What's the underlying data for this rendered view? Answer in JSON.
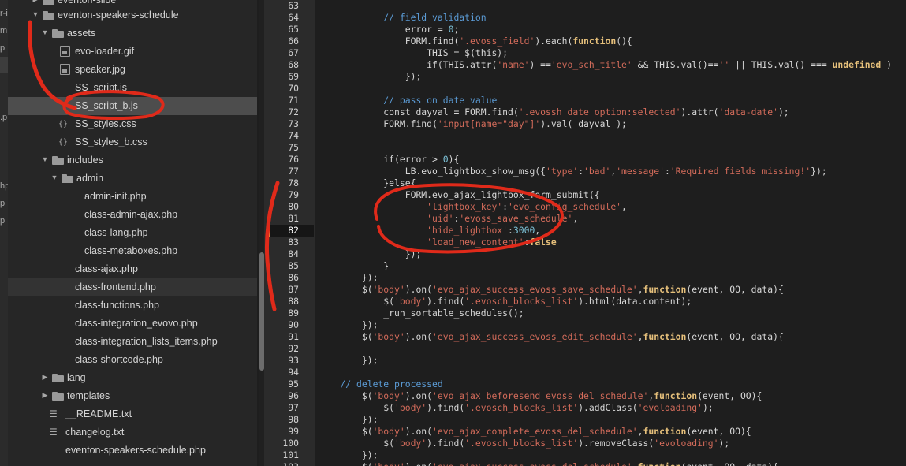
{
  "sidebar": {
    "top_cut": "eventon-slide",
    "items": [
      {
        "label": "eventon-speakers-schedule",
        "type": "folder",
        "level": 0,
        "open": true
      },
      {
        "label": "assets",
        "type": "folder",
        "level": 1,
        "open": true
      },
      {
        "label": "evo-loader.gif",
        "type": "image",
        "level": 2
      },
      {
        "label": "speaker.jpg",
        "type": "image",
        "level": 2
      },
      {
        "label": "SS_script.js",
        "type": "js",
        "level": 2
      },
      {
        "label": "SS_script_b.js",
        "type": "js",
        "level": 2,
        "active": true
      },
      {
        "label": "SS_styles.css",
        "type": "css",
        "level": 2
      },
      {
        "label": "SS_styles_b.css",
        "type": "css",
        "level": 2
      },
      {
        "label": "includes",
        "type": "folder",
        "level": 1,
        "open": true
      },
      {
        "label": "admin",
        "type": "folder",
        "level": 2,
        "open": true
      },
      {
        "label": "admin-init.php",
        "type": "php",
        "level": 3
      },
      {
        "label": "class-admin-ajax.php",
        "type": "php",
        "level": 3
      },
      {
        "label": "class-lang.php",
        "type": "php",
        "level": 3
      },
      {
        "label": "class-metaboxes.php",
        "type": "php",
        "level": 3
      },
      {
        "label": "class-ajax.php",
        "type": "php",
        "level": 2
      },
      {
        "label": "class-frontend.php",
        "type": "php",
        "level": 2,
        "hover": true
      },
      {
        "label": "class-functions.php",
        "type": "php",
        "level": 2
      },
      {
        "label": "class-integration_evovo.php",
        "type": "php",
        "level": 2
      },
      {
        "label": "class-integration_lists_items.php",
        "type": "php",
        "level": 2
      },
      {
        "label": "class-shortcode.php",
        "type": "php",
        "level": 2
      },
      {
        "label": "lang",
        "type": "folder",
        "level": 1,
        "open": false
      },
      {
        "label": "templates",
        "type": "folder",
        "level": 1,
        "open": false
      },
      {
        "label": "__README.txt",
        "type": "text",
        "level": 1
      },
      {
        "label": "changelog.txt",
        "type": "text",
        "level": 1
      },
      {
        "label": "eventon-speakers-schedule.php",
        "type": "php",
        "level": 1
      }
    ]
  },
  "leftstrip": {
    "fragments": [
      "r-i",
      "m",
      "p",
      ".p",
      "hp",
      "p",
      "p"
    ]
  },
  "editor": {
    "current_line": 82,
    "lines": [
      {
        "n": 63,
        "tokens": []
      },
      {
        "n": 64,
        "tokens": [
          [
            "comment",
            "            // field validation"
          ]
        ]
      },
      {
        "n": 65,
        "tokens": [
          [
            "plain",
            "                error = "
          ],
          [
            "number",
            "0"
          ],
          [
            "plain",
            ";"
          ]
        ]
      },
      {
        "n": 66,
        "tokens": [
          [
            "plain",
            "                FORM.find("
          ],
          [
            "string",
            "'.evoss_field'"
          ],
          [
            "plain",
            ").each("
          ],
          [
            "kw",
            "function"
          ],
          [
            "plain",
            "(){"
          ]
        ]
      },
      {
        "n": 67,
        "tokens": [
          [
            "plain",
            "                    THIS = $(this);"
          ]
        ]
      },
      {
        "n": 68,
        "tokens": [
          [
            "plain",
            "                    if(THIS.attr("
          ],
          [
            "string",
            "'name'"
          ],
          [
            "plain",
            ") =="
          ],
          [
            "string",
            "'evo_sch_title'"
          ],
          [
            "plain",
            " && THIS.val()=="
          ],
          [
            "string",
            "''"
          ],
          [
            "plain",
            " || THIS.val() === "
          ],
          [
            "kw",
            "undefined"
          ],
          [
            "plain",
            " )"
          ]
        ]
      },
      {
        "n": 69,
        "tokens": [
          [
            "plain",
            "                });"
          ]
        ]
      },
      {
        "n": 70,
        "tokens": []
      },
      {
        "n": 71,
        "tokens": [
          [
            "comment",
            "            // pass on date value"
          ]
        ]
      },
      {
        "n": 72,
        "tokens": [
          [
            "plain",
            "            const dayval = FORM.find("
          ],
          [
            "string",
            "'.evossh_date option:selected'"
          ],
          [
            "plain",
            ").attr("
          ],
          [
            "string",
            "'data-date'"
          ],
          [
            "plain",
            ");"
          ]
        ]
      },
      {
        "n": 73,
        "tokens": [
          [
            "plain",
            "            FORM.find("
          ],
          [
            "string",
            "'input[name=\"day\"]'"
          ],
          [
            "plain",
            ").val( dayval );"
          ]
        ]
      },
      {
        "n": 74,
        "tokens": []
      },
      {
        "n": 75,
        "tokens": []
      },
      {
        "n": 76,
        "tokens": [
          [
            "plain",
            "            if(error > "
          ],
          [
            "number",
            "0"
          ],
          [
            "plain",
            "){"
          ]
        ]
      },
      {
        "n": 77,
        "tokens": [
          [
            "plain",
            "                LB.evo_lightbox_show_msg({"
          ],
          [
            "string",
            "'type'"
          ],
          [
            "plain",
            ":"
          ],
          [
            "string",
            "'bad'"
          ],
          [
            "plain",
            ","
          ],
          [
            "string",
            "'message'"
          ],
          [
            "plain",
            ":"
          ],
          [
            "string",
            "'Required fields missing!'"
          ],
          [
            "plain",
            "});"
          ]
        ]
      },
      {
        "n": 78,
        "tokens": [
          [
            "plain",
            "            }else{"
          ]
        ]
      },
      {
        "n": 79,
        "tokens": [
          [
            "plain",
            "                FORM.evo_ajax_lightbox_form_submit({"
          ]
        ]
      },
      {
        "n": 80,
        "tokens": [
          [
            "plain",
            "                    "
          ],
          [
            "string",
            "'lightbox_key'"
          ],
          [
            "plain",
            ":"
          ],
          [
            "string",
            "'evo_config_schedule'"
          ],
          [
            "plain",
            ","
          ]
        ]
      },
      {
        "n": 81,
        "tokens": [
          [
            "plain",
            "                    "
          ],
          [
            "string",
            "'uid'"
          ],
          [
            "plain",
            ":"
          ],
          [
            "string",
            "'evoss_save_schedule'"
          ],
          [
            "plain",
            ","
          ]
        ]
      },
      {
        "n": 82,
        "tokens": [
          [
            "plain",
            "                    "
          ],
          [
            "string",
            "'hide_lightbox'"
          ],
          [
            "plain",
            ":"
          ],
          [
            "number",
            "3000"
          ],
          [
            "plain",
            ","
          ]
        ]
      },
      {
        "n": 83,
        "tokens": [
          [
            "plain",
            "                    "
          ],
          [
            "string",
            "'load_new_content'"
          ],
          [
            "plain",
            ":"
          ],
          [
            "kw",
            "false"
          ]
        ]
      },
      {
        "n": 84,
        "tokens": [
          [
            "plain",
            "                });"
          ]
        ]
      },
      {
        "n": 85,
        "tokens": [
          [
            "plain",
            "            }"
          ]
        ]
      },
      {
        "n": 86,
        "tokens": [
          [
            "plain",
            "        });"
          ]
        ]
      },
      {
        "n": 87,
        "tokens": [
          [
            "plain",
            "        $("
          ],
          [
            "string",
            "'body'"
          ],
          [
            "plain",
            ").on("
          ],
          [
            "string",
            "'evo_ajax_success_evoss_save_schedule'"
          ],
          [
            "plain",
            ","
          ],
          [
            "kw",
            "function"
          ],
          [
            "plain",
            "(event, OO, data){"
          ]
        ]
      },
      {
        "n": 88,
        "tokens": [
          [
            "plain",
            "            $("
          ],
          [
            "string",
            "'body'"
          ],
          [
            "plain",
            ").find("
          ],
          [
            "string",
            "'.evosch_blocks_list'"
          ],
          [
            "plain",
            ").html(data.content);"
          ]
        ]
      },
      {
        "n": 89,
        "tokens": [
          [
            "plain",
            "            _run_sortable_schedules();"
          ]
        ]
      },
      {
        "n": 90,
        "tokens": [
          [
            "plain",
            "        });"
          ]
        ]
      },
      {
        "n": 91,
        "tokens": [
          [
            "plain",
            "        $("
          ],
          [
            "string",
            "'body'"
          ],
          [
            "plain",
            ").on("
          ],
          [
            "string",
            "'evo_ajax_success_evoss_edit_schedule'"
          ],
          [
            "plain",
            ","
          ],
          [
            "kw",
            "function"
          ],
          [
            "plain",
            "(event, OO, data){"
          ]
        ]
      },
      {
        "n": 92,
        "tokens": []
      },
      {
        "n": 93,
        "tokens": [
          [
            "plain",
            "        });"
          ]
        ]
      },
      {
        "n": 94,
        "tokens": []
      },
      {
        "n": 95,
        "tokens": [
          [
            "comment",
            "    // delete processed"
          ]
        ]
      },
      {
        "n": 96,
        "tokens": [
          [
            "plain",
            "        $("
          ],
          [
            "string",
            "'body'"
          ],
          [
            "plain",
            ").on("
          ],
          [
            "string",
            "'evo_ajax_beforesend_evoss_del_schedule'"
          ],
          [
            "plain",
            ","
          ],
          [
            "kw",
            "function"
          ],
          [
            "plain",
            "(event, OO){"
          ]
        ]
      },
      {
        "n": 97,
        "tokens": [
          [
            "plain",
            "            $("
          ],
          [
            "string",
            "'body'"
          ],
          [
            "plain",
            ").find("
          ],
          [
            "string",
            "'.evosch_blocks_list'"
          ],
          [
            "plain",
            ").addClass("
          ],
          [
            "string",
            "'evoloading'"
          ],
          [
            "plain",
            ");"
          ]
        ]
      },
      {
        "n": 98,
        "tokens": [
          [
            "plain",
            "        });"
          ]
        ]
      },
      {
        "n": 99,
        "tokens": [
          [
            "plain",
            "        $("
          ],
          [
            "string",
            "'body'"
          ],
          [
            "plain",
            ").on("
          ],
          [
            "string",
            "'evo_ajax_complete_evoss_del_schedule'"
          ],
          [
            "plain",
            ","
          ],
          [
            "kw",
            "function"
          ],
          [
            "plain",
            "(event, OO){"
          ]
        ]
      },
      {
        "n": 100,
        "tokens": [
          [
            "plain",
            "            $("
          ],
          [
            "string",
            "'body'"
          ],
          [
            "plain",
            ").find("
          ],
          [
            "string",
            "'.evosch_blocks_list'"
          ],
          [
            "plain",
            ").removeClass("
          ],
          [
            "string",
            "'evoloading'"
          ],
          [
            "plain",
            ");"
          ]
        ]
      },
      {
        "n": 101,
        "tokens": [
          [
            "plain",
            "        });"
          ]
        ]
      },
      {
        "n": 102,
        "tokens": [
          [
            "plain",
            "        $("
          ],
          [
            "string",
            "'body'"
          ],
          [
            "plain",
            ").on("
          ],
          [
            "string",
            "'evo_ajax_success_evoss_del_schedule'"
          ],
          [
            "plain",
            ","
          ],
          [
            "kw",
            "function"
          ],
          [
            "plain",
            "(event, OO, data){"
          ]
        ]
      }
    ]
  },
  "colors": {
    "annotation": "#e02a1a",
    "accent_current_line": "#e0b94d"
  }
}
